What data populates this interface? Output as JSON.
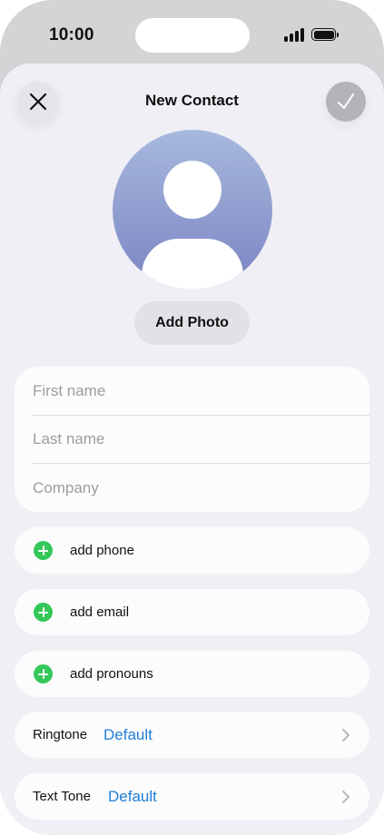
{
  "status_bar": {
    "time": "10:00",
    "icons": [
      "signal-icon",
      "battery-icon"
    ]
  },
  "nav": {
    "title": "New Contact",
    "close_icon": "close-icon",
    "done_icon": "checkmark-icon"
  },
  "avatar": {
    "icon": "person-placeholder-icon",
    "add_photo_label": "Add Photo"
  },
  "name_fields": {
    "first_name_placeholder": "First name",
    "last_name_placeholder": "Last name",
    "company_placeholder": "Company"
  },
  "add_rows": [
    {
      "label": "add phone",
      "icon": "plus-circle-icon"
    },
    {
      "label": "add email",
      "icon": "plus-circle-icon"
    },
    {
      "label": "add pronouns",
      "icon": "plus-circle-icon"
    }
  ],
  "tone_rows": [
    {
      "label": "Ringtone",
      "value": "Default",
      "icon": "chevron-right-icon"
    },
    {
      "label": "Text Tone",
      "value": "Default",
      "icon": "chevron-right-icon"
    }
  ],
  "colors": {
    "accent_blue": "#1f7fd6",
    "add_green": "#34c759",
    "sheet_background": "#f0eff5",
    "avatar_gradient_top": "#a7b9dd",
    "avatar_gradient_bottom": "#7b84c3"
  }
}
